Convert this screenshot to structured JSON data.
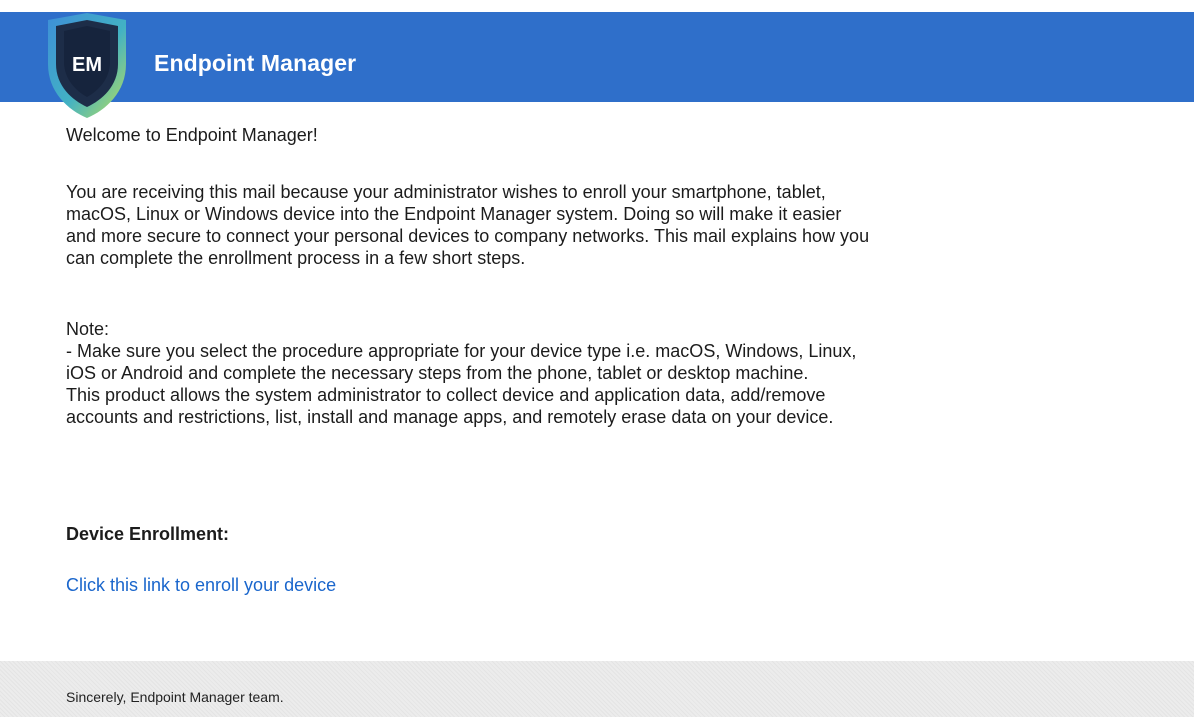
{
  "header": {
    "logo_text": "EM",
    "title": "Endpoint Manager",
    "bg_color": "#2f6fca"
  },
  "body": {
    "greeting": "Welcome to Endpoint Manager!",
    "intro": "You are receiving this mail because your administrator wishes to enroll your smartphone, tablet,\nmacOS, Linux or Windows device into the Endpoint Manager system. Doing so will make it easier\nand more secure to connect your personal devices to company networks. This mail explains how you\ncan complete the enrollment process in a few short steps.",
    "note_label": "Note:",
    "note_text": "- Make sure you select the procedure appropriate for your device type i.e. macOS, Windows, Linux,\niOS or Android and complete the necessary steps from the phone, tablet or desktop machine.\nThis product allows the system administrator to collect device and application data, add/remove\naccounts and restrictions, list, install and manage apps, and remotely erase data on your device.",
    "section_heading": "Device Enrollment:",
    "enroll_link_text": "Click this link to enroll your device",
    "link_color": "#1a66cc"
  },
  "footer": {
    "signoff": "Sincerely, Endpoint Manager team."
  }
}
